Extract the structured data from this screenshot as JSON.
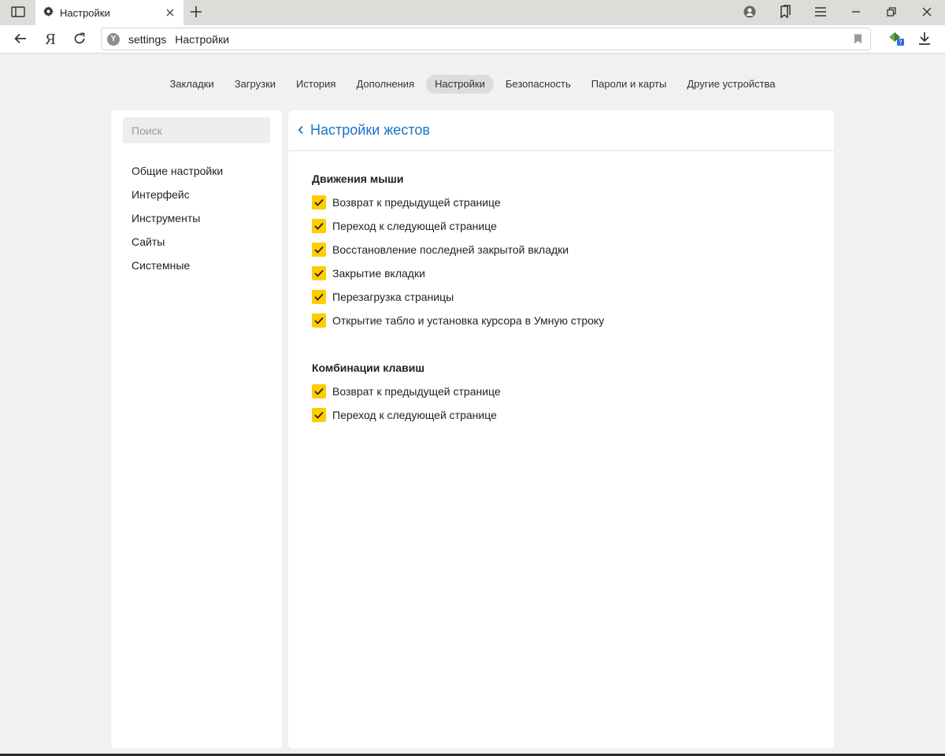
{
  "tab": {
    "title": "Настройки"
  },
  "address": {
    "host": "settings",
    "page_title": "Настройки"
  },
  "nav": {
    "items": [
      {
        "label": "Закладки",
        "active": false
      },
      {
        "label": "Загрузки",
        "active": false
      },
      {
        "label": "История",
        "active": false
      },
      {
        "label": "Дополнения",
        "active": false
      },
      {
        "label": "Настройки",
        "active": true
      },
      {
        "label": "Безопасность",
        "active": false
      },
      {
        "label": "Пароли и карты",
        "active": false
      },
      {
        "label": "Другие устройства",
        "active": false
      }
    ]
  },
  "sidebar": {
    "search_placeholder": "Поиск",
    "items": [
      {
        "label": "Общие настройки"
      },
      {
        "label": "Интерфейс"
      },
      {
        "label": "Инструменты"
      },
      {
        "label": "Сайты"
      },
      {
        "label": "Системные"
      }
    ]
  },
  "main": {
    "title": "Настройки жестов",
    "mouse": {
      "heading": "Движения мыши",
      "options": [
        {
          "label": "Возврат к предыдущей странице",
          "checked": true
        },
        {
          "label": "Переход к следующей странице",
          "checked": true
        },
        {
          "label": "Восстановление последней закрытой вкладки",
          "checked": true
        },
        {
          "label": "Закрытие вкладки",
          "checked": true
        },
        {
          "label": "Перезагрузка страницы",
          "checked": true
        },
        {
          "label": "Открытие табло и установка курсора в Умную строку",
          "checked": true
        }
      ]
    },
    "keys": {
      "heading": "Комбинации клавиш",
      "options": [
        {
          "label": "Возврат к предыдущей странице",
          "checked": true
        },
        {
          "label": "Переход к следующей странице",
          "checked": true
        }
      ]
    }
  },
  "colors": {
    "accent": "#ffcc00",
    "link": "#1a73c8",
    "page_bg": "#f2f1ef"
  }
}
